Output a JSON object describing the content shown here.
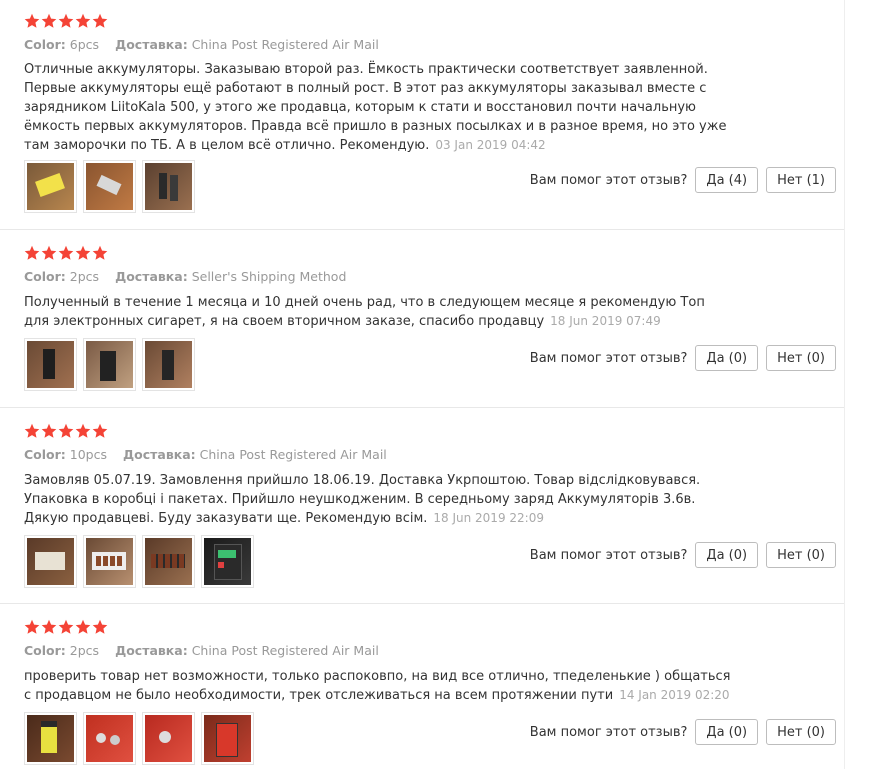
{
  "colors": {
    "star": "#f44336",
    "meta": "#999999",
    "text": "#333333",
    "date": "#aaaaaa"
  },
  "labels": {
    "color_key": "Color:",
    "shipping_key": "Доставка:",
    "helpful_question": "Вам помог этот отзыв?"
  },
  "reviews": [
    {
      "stars": 5,
      "color": "6pcs",
      "shipping": "China Post Registered Air Mail",
      "text": "Отличные аккумуляторы. Заказываю второй раз. Ёмкость практически соответствует заявленной. Первые аккумуляторы ещё работают в полный рост. В этот раз аккумуляторы заказывал вместе с зарядником LiitoKala 500, у этого же продавца, которым к стати и восстановил почти начальную ёмкость первых аккумуляторов. Правда всё пришло в разных посылках и в разное время, но это уже там заморочки по ТБ. А в целом всё отлично. Рекомендую.",
      "date": "03 Jan 2019 04:42",
      "yes_label": "Да (4)",
      "no_label": "Нет (1)",
      "photos": [
        "photo-yellow-batteries",
        "photo-package",
        "photo-batteries-hand"
      ]
    },
    {
      "stars": 5,
      "color": "2pcs",
      "shipping": "Seller's Shipping Method",
      "text": "Полученный в течение 1 месяца и 10 дней очень рад, что в следующем месяце я рекомендую Топ для электронных сигарет, я на своем вторичном заказе, спасибо продавцу",
      "date": "18 Jun 2019 07:49",
      "yes_label": "Да (0)",
      "no_label": "Нет (0)",
      "photos": [
        "photo-battery-hand-1",
        "photo-battery-hand-2",
        "photo-battery-hand-3"
      ]
    },
    {
      "stars": 5,
      "color": "10pcs",
      "shipping": "China Post Registered Air Mail",
      "text": "Замовляв 05.07.19. Замовлення прийшло 18.06.19. Доставка Укрпоштою. Товар відслідковувався. Упаковка в коробці і пакетах. Прийшло неушкодженим. В середньому заряд Аккумуляторів 3.6в. Дякую продавцеві. Буду заказувати ще. Рекомендую всім.",
      "date": "18 Jun 2019 22:09",
      "yes_label": "Да (0)",
      "no_label": "Нет (0)",
      "photos": [
        "photo-box-open",
        "photo-box-batteries",
        "photo-box-batteries-2",
        "photo-charger"
      ]
    },
    {
      "stars": 5,
      "color": "2pcs",
      "shipping": "China Post Registered Air Mail",
      "text": "проверить товар нет возможности, только распоковпо, на вид все отлично, тпеделенькие ) общаться с продавцом не было необходимости, трек отслеживаться на всем протяжении пути",
      "date": "14 Jan 2019 02:20",
      "yes_label": "Да (0)",
      "no_label": "Нет (0)",
      "photos": [
        "photo-yellow-red",
        "photo-red-tops",
        "photo-red-tops-2",
        "photo-red-side"
      ]
    }
  ]
}
